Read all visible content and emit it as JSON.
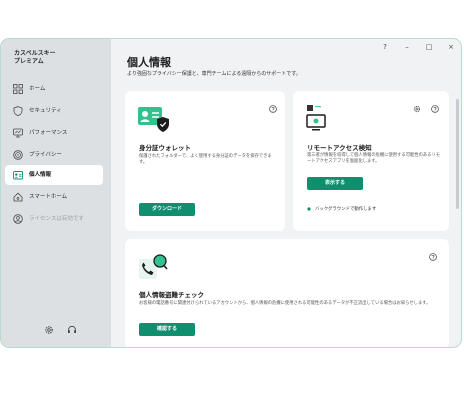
{
  "window": {
    "controls": {
      "help": "?",
      "minimize": "–",
      "maximize": "□",
      "close": "×"
    }
  },
  "sidebar": {
    "brand_line1": "カスペルスキー",
    "brand_line2": "プレミアム",
    "items": [
      {
        "label": "ホーム",
        "icon": "home-grid-icon"
      },
      {
        "label": "セキュリティ",
        "icon": "shield-icon"
      },
      {
        "label": "パフォーマンス",
        "icon": "monitor-icon"
      },
      {
        "label": "プライバシー",
        "icon": "fingerprint-icon"
      },
      {
        "label": "個人情報",
        "icon": "id-card-icon"
      },
      {
        "label": "スマートホーム",
        "icon": "smart-home-icon"
      },
      {
        "label": "ライセンスは有効です",
        "icon": "user-circle-icon"
      }
    ],
    "active_index": 4,
    "bottom_icons": [
      "settings-icon",
      "support-headset-icon"
    ]
  },
  "main": {
    "title": "個人情報",
    "subtitle": "より強固なプライバシー保護と、専門チームによる遠隔からのサポートです。",
    "cards": {
      "wallet": {
        "title": "身分証ウォレット",
        "description": "保護されたフォルダーで、よく使用する身分証のデータを保存できます。",
        "button": "ダウンロード"
      },
      "remote": {
        "title": "リモートアクセス検知",
        "description": "第三者が情報を収得して個人情報の危機に使用する可能性のあるリモートアクセスアプリを面面化します。",
        "button": "表示する",
        "status": "バックグラウンドで動作します"
      },
      "leak": {
        "title": "個人情報盗難チェック",
        "description": "お客様の電話番号に関連付けられているアカウントから、個人情報の危機に使用される可能性のあるデータが不正流出している場合はお知らせします。",
        "button": "確認する"
      }
    }
  },
  "colors": {
    "accent": "#0f8f6e",
    "sidebar_bg": "#dde0e2",
    "main_bg": "#f1f2f3",
    "card_bg": "#ffffff"
  }
}
